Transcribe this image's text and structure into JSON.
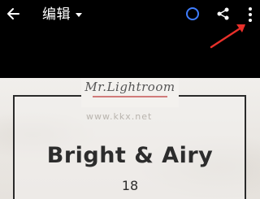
{
  "header": {
    "title": "编辑",
    "icons": {
      "back": "back-arrow-icon",
      "dropdown": "caret-down-icon",
      "sync": "sync-status-icon",
      "share": "share-icon",
      "more": "more-vertical-icon"
    }
  },
  "preset": {
    "logo_text": "Mr.Lightroom",
    "watermark": "www.kkx.net",
    "name": "Bright & Airy",
    "count": "18"
  },
  "colors": {
    "background": "#000000",
    "sync_ring": "#3f7dff",
    "annotation_arrow": "#e8302a",
    "photo_bg": "#efece8",
    "heading_text": "#2c2c2c"
  }
}
